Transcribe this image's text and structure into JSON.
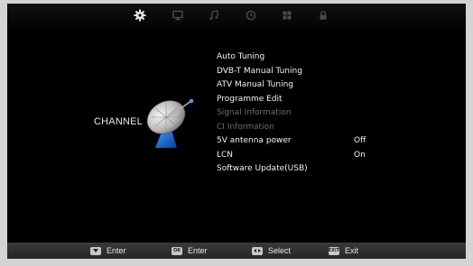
{
  "tabs": [
    {
      "icon": "gear-icon",
      "active": true
    },
    {
      "icon": "monitor-icon",
      "active": false
    },
    {
      "icon": "music-note-icon",
      "active": false
    },
    {
      "icon": "clock-icon",
      "active": false
    },
    {
      "icon": "grid-icon",
      "active": false
    },
    {
      "icon": "lock-icon",
      "active": false
    }
  ],
  "section": {
    "title": "CHANNEL",
    "icon": "satellite-dish-icon"
  },
  "menu": [
    {
      "label": "Auto Tuning",
      "value": "",
      "enabled": true
    },
    {
      "label": "DVB-T Manual Tuning",
      "value": "",
      "enabled": true
    },
    {
      "label": "ATV Manual Tuning",
      "value": "",
      "enabled": true
    },
    {
      "label": "Programme Edit",
      "value": "",
      "enabled": true
    },
    {
      "label": "Signal Information",
      "value": "",
      "enabled": false
    },
    {
      "label": "CI Information",
      "value": "",
      "enabled": false
    },
    {
      "label": "5V antenna power",
      "value": "Off",
      "enabled": true
    },
    {
      "label": "LCN",
      "value": "On",
      "enabled": true
    },
    {
      "label": "Software Update(USB)",
      "value": "",
      "enabled": true
    }
  ],
  "hints": [
    {
      "key_icon": "down-arrow-key-icon",
      "key_text": "",
      "label": "Enter"
    },
    {
      "key_icon": "ok-key-icon",
      "key_text": "OK",
      "label": "Enter"
    },
    {
      "key_icon": "left-right-key-icon",
      "key_text": "",
      "label": "Select"
    },
    {
      "key_icon": "exit-key-icon",
      "key_text": "EXIT",
      "label": "Exit"
    }
  ],
  "colors": {
    "active_tab": "#e8e8e8",
    "inactive_tab": "#4a4a4a",
    "text": "#f2f2f2",
    "disabled_text": "#6e6e6e",
    "bottom_bar": "#2e2e2e"
  }
}
